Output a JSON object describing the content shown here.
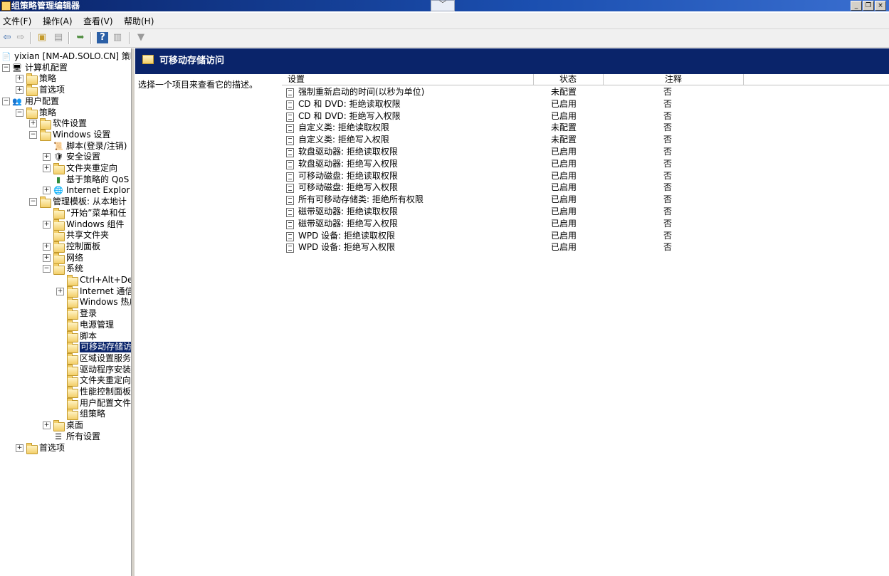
{
  "window": {
    "title": "组策略管理编辑器"
  },
  "menu": [
    "文件(F)",
    "操作(A)",
    "查看(V)",
    "帮助(H)"
  ],
  "tree": [
    {
      "label": "yixian [NM-AD.SOLO.CN] 策略",
      "icon": "policy-doc-icon",
      "depth": 0,
      "expander": ""
    },
    {
      "label": "计算机配置",
      "icon": "computer-icon",
      "depth": 0,
      "expander": "minus"
    },
    {
      "label": "策略",
      "icon": "folder-icon",
      "depth": 1,
      "expander": "plus"
    },
    {
      "label": "首选项",
      "icon": "folder-icon",
      "depth": 1,
      "expander": "plus"
    },
    {
      "label": "用户配置",
      "icon": "users-icon",
      "depth": 0,
      "expander": "minus"
    },
    {
      "label": "策略",
      "icon": "folder-icon",
      "depth": 1,
      "expander": "minus"
    },
    {
      "label": "软件设置",
      "icon": "folder-icon",
      "depth": 2,
      "expander": "plus"
    },
    {
      "label": "Windows 设置",
      "icon": "folder-icon",
      "depth": 2,
      "expander": "minus"
    },
    {
      "label": "脚本(登录/注销)",
      "icon": "script-icon",
      "depth": 3,
      "expander": ""
    },
    {
      "label": "安全设置",
      "icon": "security-icon",
      "depth": 3,
      "expander": "plus"
    },
    {
      "label": "文件夹重定向",
      "icon": "folder-icon",
      "depth": 3,
      "expander": "plus"
    },
    {
      "label": "基于策略的 QoS",
      "icon": "chart-icon",
      "depth": 3,
      "expander": ""
    },
    {
      "label": "Internet Explor",
      "icon": "ie-icon",
      "depth": 3,
      "expander": "plus"
    },
    {
      "label": "管理模板: 从本地计",
      "icon": "folder-icon",
      "depth": 2,
      "expander": "minus"
    },
    {
      "label": "“开始”菜单和任",
      "icon": "folder-icon",
      "depth": 3,
      "expander": ""
    },
    {
      "label": "Windows 组件",
      "icon": "folder-icon",
      "depth": 3,
      "expander": "plus"
    },
    {
      "label": "共享文件夹",
      "icon": "folder-icon",
      "depth": 3,
      "expander": ""
    },
    {
      "label": "控制面板",
      "icon": "folder-icon",
      "depth": 3,
      "expander": "plus"
    },
    {
      "label": "网络",
      "icon": "folder-icon",
      "depth": 3,
      "expander": "plus"
    },
    {
      "label": "系统",
      "icon": "folder-icon",
      "depth": 3,
      "expander": "minus"
    },
    {
      "label": "Ctrl+Alt+Del",
      "icon": "folder-icon",
      "depth": 4,
      "expander": ""
    },
    {
      "label": "Internet 通信",
      "icon": "folder-icon",
      "depth": 4,
      "expander": "plus"
    },
    {
      "label": "Windows 热启",
      "icon": "folder-icon",
      "depth": 4,
      "expander": ""
    },
    {
      "label": "登录",
      "icon": "folder-icon",
      "depth": 4,
      "expander": ""
    },
    {
      "label": "电源管理",
      "icon": "folder-icon",
      "depth": 4,
      "expander": ""
    },
    {
      "label": "脚本",
      "icon": "folder-icon",
      "depth": 4,
      "expander": ""
    },
    {
      "label": "可移动存储访",
      "icon": "folder-icon",
      "depth": 4,
      "expander": "",
      "selected": true
    },
    {
      "label": "区域设置服务",
      "icon": "folder-icon",
      "depth": 4,
      "expander": ""
    },
    {
      "label": "驱动程序安装",
      "icon": "folder-icon",
      "depth": 4,
      "expander": ""
    },
    {
      "label": "文件夹重定向",
      "icon": "folder-icon",
      "depth": 4,
      "expander": ""
    },
    {
      "label": "性能控制面板",
      "icon": "folder-icon",
      "depth": 4,
      "expander": ""
    },
    {
      "label": "用户配置文件",
      "icon": "folder-icon",
      "depth": 4,
      "expander": ""
    },
    {
      "label": "组策略",
      "icon": "folder-icon",
      "depth": 4,
      "expander": ""
    },
    {
      "label": "桌面",
      "icon": "folder-icon",
      "depth": 3,
      "expander": "plus"
    },
    {
      "label": "所有设置",
      "icon": "all-settings-icon",
      "depth": 3,
      "expander": ""
    },
    {
      "label": "首选项",
      "icon": "folder-icon",
      "depth": 1,
      "expander": "plus"
    }
  ],
  "details": {
    "title": "可移动存储访问",
    "description": "选择一个项目来查看它的描述。",
    "columns": {
      "name": "设置",
      "state": "状态",
      "note": "注释"
    },
    "rows": [
      {
        "name": "强制重新启动的时间(以秒为单位)",
        "state": "未配置",
        "note": "否"
      },
      {
        "name": "CD 和 DVD: 拒绝读取权限",
        "state": "已启用",
        "note": "否"
      },
      {
        "name": "CD 和 DVD: 拒绝写入权限",
        "state": "已启用",
        "note": "否"
      },
      {
        "name": "自定义类: 拒绝读取权限",
        "state": "未配置",
        "note": "否"
      },
      {
        "name": "自定义类: 拒绝写入权限",
        "state": "未配置",
        "note": "否"
      },
      {
        "name": "软盘驱动器: 拒绝读取权限",
        "state": "已启用",
        "note": "否"
      },
      {
        "name": "软盘驱动器: 拒绝写入权限",
        "state": "已启用",
        "note": "否"
      },
      {
        "name": "可移动磁盘: 拒绝读取权限",
        "state": "已启用",
        "note": "否"
      },
      {
        "name": "可移动磁盘: 拒绝写入权限",
        "state": "已启用",
        "note": "否"
      },
      {
        "name": "所有可移动存储类: 拒绝所有权限",
        "state": "已启用",
        "note": "否"
      },
      {
        "name": "磁带驱动器: 拒绝读取权限",
        "state": "已启用",
        "note": "否"
      },
      {
        "name": "磁带驱动器: 拒绝写入权限",
        "state": "已启用",
        "note": "否"
      },
      {
        "name": "WPD 设备: 拒绝读取权限",
        "state": "已启用",
        "note": "否"
      },
      {
        "name": "WPD 设备: 拒绝写入权限",
        "state": "已启用",
        "note": "否"
      }
    ]
  }
}
